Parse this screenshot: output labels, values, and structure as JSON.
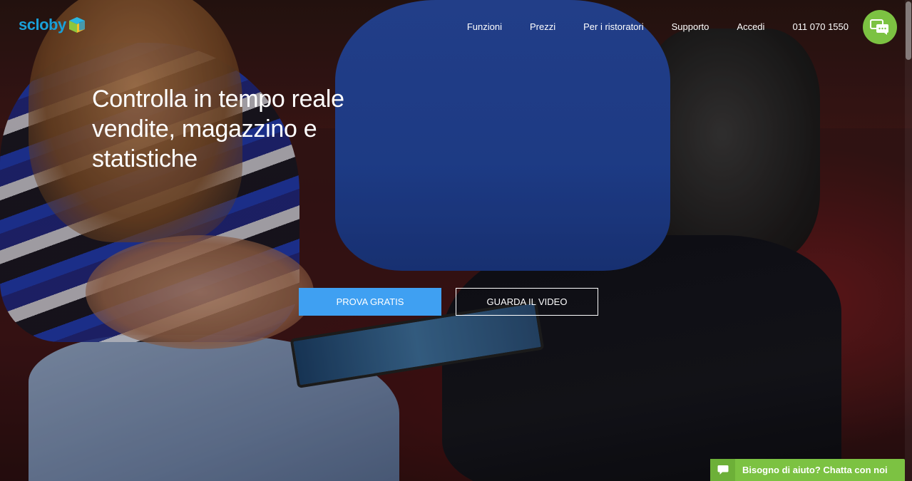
{
  "header": {
    "logo_text": "scloby",
    "nav": [
      {
        "label": "Funzioni"
      },
      {
        "label": "Prezzi"
      },
      {
        "label": "Per i ristoratori"
      },
      {
        "label": "Supporto"
      },
      {
        "label": "Accedi"
      },
      {
        "label": "011 070 1550"
      }
    ],
    "chat_icon": "chat-bubbles-icon"
  },
  "hero": {
    "headline": "Controlla in tempo reale vendite, magazzino e statistiche",
    "primary_cta": "PROVA GRATIS",
    "secondary_cta": "GUARDA IL VIDEO"
  },
  "help_chat": {
    "icon": "speech-bubble-icon",
    "label": "Bisogno di aiuto? Chatta con noi"
  },
  "colors": {
    "brand_blue": "#1aa0d8",
    "cta_blue": "#3fa0f2",
    "chat_green": "#7cc242"
  }
}
